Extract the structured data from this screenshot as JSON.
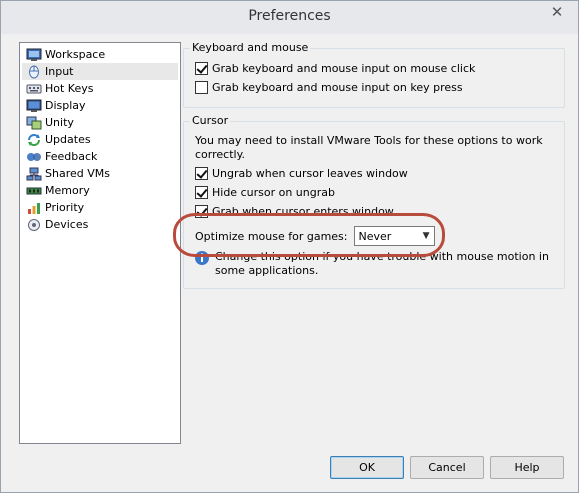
{
  "window": {
    "title": "Preferences"
  },
  "nav": {
    "items": [
      {
        "label": "Workspace",
        "icon": "workspace-icon"
      },
      {
        "label": "Input",
        "icon": "mouse-icon",
        "selected": true
      },
      {
        "label": "Hot Keys",
        "icon": "hotkeys-icon"
      },
      {
        "label": "Display",
        "icon": "display-icon"
      },
      {
        "label": "Unity",
        "icon": "unity-icon"
      },
      {
        "label": "Updates",
        "icon": "updates-icon"
      },
      {
        "label": "Feedback",
        "icon": "feedback-icon"
      },
      {
        "label": "Shared VMs",
        "icon": "shared-vms-icon"
      },
      {
        "label": "Memory",
        "icon": "memory-icon"
      },
      {
        "label": "Priority",
        "icon": "priority-icon"
      },
      {
        "label": "Devices",
        "icon": "devices-icon"
      }
    ]
  },
  "keyboard_mouse": {
    "title": "Keyboard and mouse",
    "options": [
      {
        "label": "Grab keyboard and mouse input on mouse click",
        "checked": true
      },
      {
        "label": "Grab keyboard and mouse input on key press",
        "checked": false
      }
    ]
  },
  "cursor": {
    "title": "Cursor",
    "info": "You may need to install VMware Tools for these options to work correctly.",
    "options": [
      {
        "label": "Ungrab when cursor leaves window",
        "checked": true
      },
      {
        "label": "Hide cursor on ungrab",
        "checked": true
      },
      {
        "label": "Grab when cursor enters window",
        "checked": true
      }
    ],
    "optimize_label": "Optimize mouse for games:",
    "optimize_value": "Never",
    "hint": "Change this option if you have trouble with mouse motion in some applications."
  },
  "buttons": {
    "ok": "OK",
    "cancel": "Cancel",
    "help": "Help"
  },
  "colors": {
    "highlight": "#b84b3b",
    "accent": "#3c7fb1"
  }
}
